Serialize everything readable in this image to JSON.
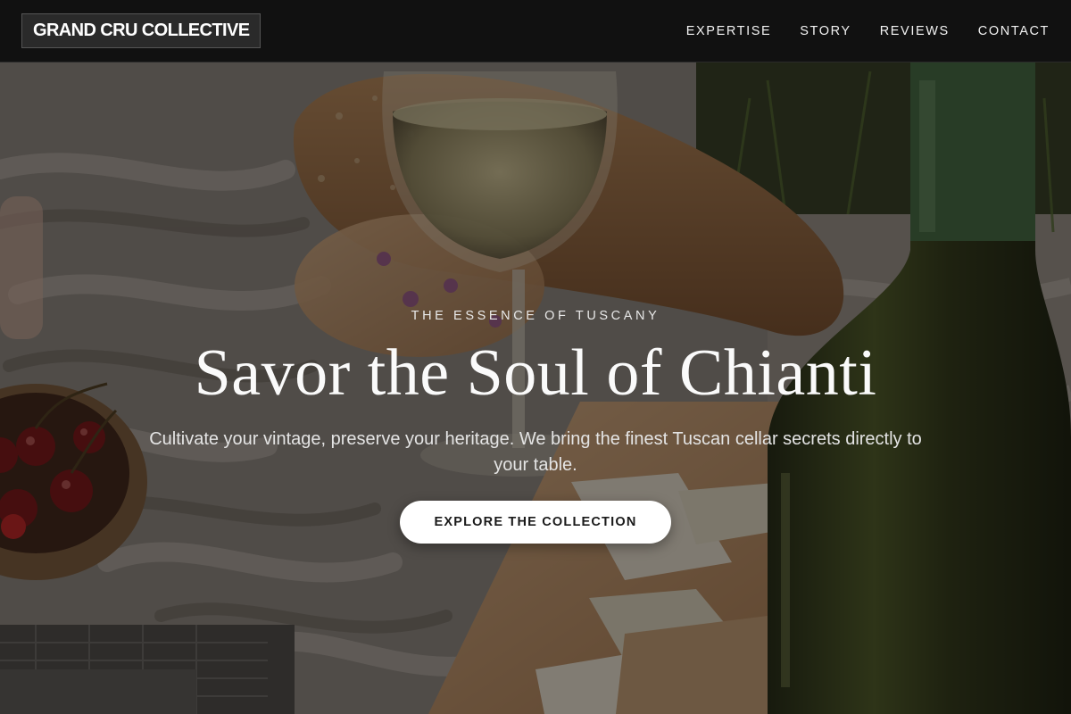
{
  "header": {
    "brand": "GRAND CRU COLLECTIVE",
    "nav": [
      {
        "label": "EXPERTISE"
      },
      {
        "label": "STORY"
      },
      {
        "label": "REVIEWS"
      },
      {
        "label": "CONTACT"
      }
    ]
  },
  "hero": {
    "eyebrow": "THE ESSENCE OF TUSCANY",
    "headline": "Savor the Soul of Chianti",
    "subtitle": "Cultivate your vintage, preserve your heritage. We bring the finest Tuscan cellar secrets directly to your table.",
    "cta_label": "EXPLORE THE COLLECTION"
  },
  "colors": {
    "header_bg": "#111111",
    "cta_bg": "#ffffff",
    "cta_text": "#1a1a1a"
  }
}
